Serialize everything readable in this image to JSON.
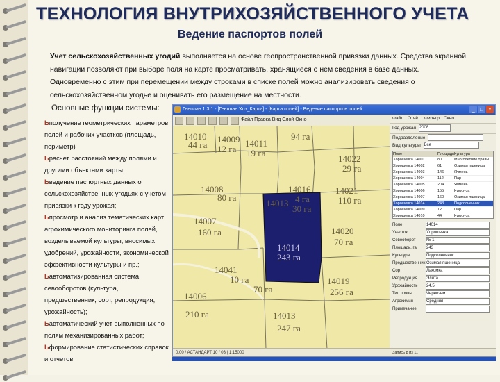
{
  "slide": {
    "title": "ТЕХНОЛОГИЯ ВНУТРИХОЗЯЙСТВЕННОГО УЧЕТА",
    "subtitle": "Ведение паспортов полей",
    "intro_lead": "Учет сельскохозяйственных угодий",
    "intro_text": " выполняется на основе геопространственной привязки данных. Средства экранной навигации позволяют при выборе поля на карте просматривать, хранящиеся о нем сведения в базе данных. Одновременно с этим при перемещении между строками в списке полей можно анализировать сведения о сельскохозяйственном угодье и оценивать его размещение на местности.",
    "functions_title": "Основные функции системы:",
    "bullet_glyph": "Ь",
    "functions": [
      "получение геометрических параметров полей и рабочих участков (площадь, периметр)",
      "расчет расстояний между полями и другими объектами карты;",
      "ведение паспортных данных о сельскохозяйственных угодьях с учетом привязки к году урожая;",
      "просмотр и анализ тематических карт агрохимического мониторинга полей, возделываемой культуры, вносимых удобрений, урожайности, экономической эффективности культуры и пр.;",
      "автоматизированная система севооборотов (культура, предшественник, сорт, репродукция, урожайность);",
      "автоматический учет выполненных по полям механизированных работ;",
      "формирование статистических справок и отчетов."
    ]
  },
  "app": {
    "window_title": "Генплан 1.3.1 - [Генплан Хоз_Карта] - [Карта полей] - Ведение паспортов полей",
    "map_toolbar_text": "Файл  Правка  Вид  Слой  Окно",
    "map_status": "0.00 / АСТАНДАРТ 10 / 03 | 1:15000",
    "menu": [
      "Файл",
      "Отчёт",
      "Фильтр",
      "Окно"
    ],
    "year_label": "Год урожая",
    "year_value": "2008",
    "field_filter_label": "Подразделение",
    "field_filter_value": "",
    "crop_filter_label": "Вид культуры",
    "crop_filter_value": "Все",
    "grid_headers": [
      "Поле",
      "Площадь",
      "Культура"
    ],
    "grid_rows": [
      [
        "Хорошевка 14001",
        "80",
        "Многолетние травы"
      ],
      [
        "Хорошевка 14002",
        "61",
        "Озимая пшеница"
      ],
      [
        "Хорошевка 14003",
        "146",
        "Ячмень"
      ],
      [
        "Хорошевка 14004",
        "112",
        "Пар"
      ],
      [
        "Хорошевка 14005",
        "204",
        "Ячмень"
      ],
      [
        "Хорошевка 14006",
        "155",
        "Кукуруза"
      ],
      [
        "Хорошевка 14007",
        "160",
        "Озимая пшеница"
      ],
      [
        "Хорошевка 14014",
        "243",
        "Подсолнечник"
      ],
      [
        "Хорошевка 14009",
        "12",
        "Пар"
      ],
      [
        "Хорошевка 14010",
        "44",
        "Кукуруза"
      ],
      [
        "Хорошевка 14011",
        "19",
        "Ячмень"
      ]
    ],
    "selected_row": 7,
    "form": [
      [
        "Поле",
        "14014"
      ],
      [
        "Участок",
        "Хорошевка"
      ],
      [
        "Севооборот",
        "№ 1"
      ],
      [
        "Площадь, га",
        "243"
      ],
      [
        "Культура",
        "Подсолнечник"
      ],
      [
        "Предшественник",
        "Озимая пшеница"
      ],
      [
        "Сорт",
        "Лакомка"
      ],
      [
        "Репродукция",
        "Элита"
      ],
      [
        "Урожайность",
        "24.5"
      ],
      [
        "Тип почвы",
        "Чернозем"
      ],
      [
        "Агрохимия",
        "Средняя"
      ],
      [
        "Примечание",
        ""
      ]
    ],
    "panel_status": "Запись 8 из 11",
    "map_fields": [
      {
        "id": "14010",
        "area": "44 га"
      },
      {
        "id": "14009",
        "area": "12 га"
      },
      {
        "id": "14011",
        "area": "19 га"
      },
      {
        "id": "94 га",
        "area": ""
      },
      {
        "id": "14022",
        "area": "29 га"
      },
      {
        "id": "14008",
        "area": "80 га"
      },
      {
        "id": "14016",
        "area": "4 га"
      },
      {
        "id": "14021",
        "area": "110 га"
      },
      {
        "id": "14013",
        "area": "30 га"
      },
      {
        "id": "14007",
        "area": "160 га"
      },
      {
        "id": "14014",
        "area": "243 га"
      },
      {
        "id": "14020",
        "area": "70 га"
      },
      {
        "id": "14041",
        "area": "10 га"
      },
      {
        "id": "14019",
        "area": "256 га"
      },
      {
        "id": "14006",
        "area": "210 га"
      },
      {
        "id": "14013",
        "area": "247 га"
      },
      {
        "id": "70 га",
        "area": ""
      }
    ],
    "colors": {
      "field_fill": "#efe8a7",
      "selected_field": "#1c1f6e",
      "boundary": "#7a7562",
      "road": "#f6f2da"
    }
  }
}
